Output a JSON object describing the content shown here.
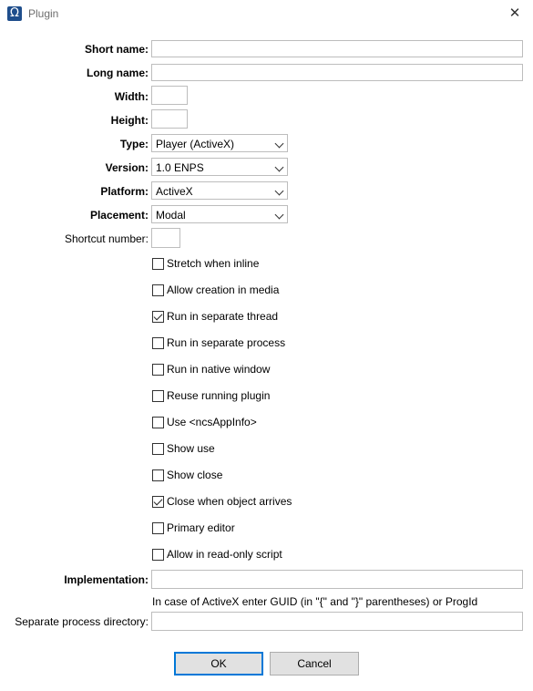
{
  "window": {
    "title": "Plugin",
    "icon": "omega-icon",
    "close_icon": "close-icon"
  },
  "form": {
    "short_name": {
      "label": "Short name:",
      "value": ""
    },
    "long_name": {
      "label": "Long name:",
      "value": ""
    },
    "width": {
      "label": "Width:",
      "value": ""
    },
    "height": {
      "label": "Height:",
      "value": ""
    },
    "type": {
      "label": "Type:",
      "value": "Player (ActiveX)"
    },
    "version": {
      "label": "Version:",
      "value": "1.0 ENPS"
    },
    "platform": {
      "label": "Platform:",
      "value": "ActiveX"
    },
    "placement": {
      "label": "Placement:",
      "value": "Modal"
    },
    "shortcut_number": {
      "label": "Shortcut number:",
      "value": ""
    },
    "checkboxes": [
      {
        "label": "Stretch when inline",
        "checked": false
      },
      {
        "label": "Allow creation in media",
        "checked": false
      },
      {
        "label": "Run in separate thread",
        "checked": true
      },
      {
        "label": "Run in separate process",
        "checked": false
      },
      {
        "label": "Run in native window",
        "checked": false
      },
      {
        "label": "Reuse running plugin",
        "checked": false
      },
      {
        "label": "Use <ncsAppInfo>",
        "checked": false
      },
      {
        "label": "Show use",
        "checked": false
      },
      {
        "label": "Show close",
        "checked": false
      },
      {
        "label": "Close when object arrives",
        "checked": true
      },
      {
        "label": "Primary editor",
        "checked": false
      },
      {
        "label": "Allow in read-only script",
        "checked": false
      }
    ],
    "implementation": {
      "label": "Implementation:",
      "value": "",
      "hint": "In case of ActiveX enter GUID (in \"{\" and \"}\" parentheses) or ProgId"
    },
    "separate_process_directory": {
      "label": "Separate process directory:",
      "value": ""
    }
  },
  "buttons": {
    "ok": "OK",
    "cancel": "Cancel"
  }
}
